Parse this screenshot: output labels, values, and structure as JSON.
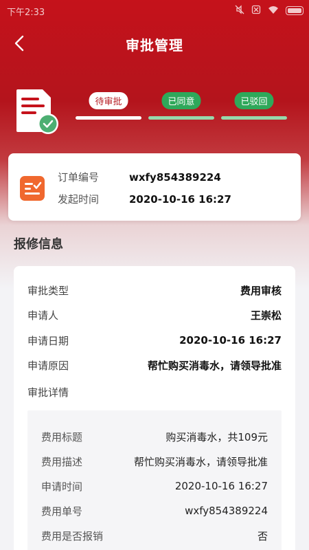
{
  "statusbar": {
    "time": "下午2:33"
  },
  "header": {
    "title": "审批管理"
  },
  "steps": [
    {
      "label": "待审批",
      "state": "active"
    },
    {
      "label": "已同意",
      "state": "done"
    },
    {
      "label": "已驳回",
      "state": "done"
    }
  ],
  "order": {
    "number_label": "订单编号",
    "number_value": "wxfy854389224",
    "time_label": "发起时间",
    "time_value": "2020-10-16 16:27"
  },
  "section": {
    "title": "报修信息"
  },
  "info": {
    "rows": [
      {
        "label": "审批类型",
        "value": "费用审核"
      },
      {
        "label": "申请人",
        "value": "王崇松"
      },
      {
        "label": "申请日期",
        "value": "2020-10-16 16:27"
      },
      {
        "label": "申请原因",
        "value": "帮忙购买消毒水，请领导批准"
      }
    ],
    "detail_label": "审批详情",
    "details": [
      {
        "label": "费用标题",
        "value": "购买消毒水，共109元"
      },
      {
        "label": "费用描述",
        "value": "帮忙购买消毒水，请领导批准"
      },
      {
        "label": "申请时间",
        "value": "2020-10-16 16:27"
      },
      {
        "label": "费用单号",
        "value": "wxfy854389224"
      },
      {
        "label": "费用是否报销",
        "value": "否"
      }
    ]
  },
  "colors": {
    "brand_red": "#c5121b",
    "approved_green": "#2fa85a",
    "order_icon_orange": "#f0682e"
  },
  "icons": {
    "back": "chevron-left-icon",
    "document": "document-check-icon",
    "order": "checklist-icon"
  }
}
